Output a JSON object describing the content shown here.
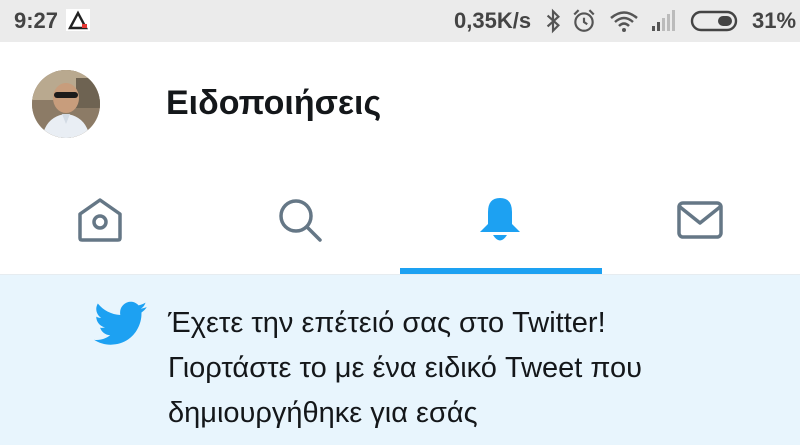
{
  "status_bar": {
    "time": "9:27",
    "network_speed": "0,35K/s",
    "battery_percent": "31%",
    "icons": [
      "bluetooth-icon",
      "alarm-icon",
      "wifi-icon",
      "signal-icon",
      "battery-icon"
    ]
  },
  "header": {
    "title": "Ειδοποιήσεις"
  },
  "tabs": [
    {
      "name": "home",
      "icon": "home-icon",
      "active": false
    },
    {
      "name": "search",
      "icon": "search-icon",
      "active": false
    },
    {
      "name": "notifications",
      "icon": "bell-icon",
      "active": true
    },
    {
      "name": "messages",
      "icon": "mail-icon",
      "active": false
    }
  ],
  "notification": {
    "line1": "Έχετε την επέτειό σας στο Twitter!",
    "line2": "Γιορτάστε το με ένα ειδικό Tweet που",
    "line3": "δημιουργήθηκε για εσάς",
    "icon": "twitter-bird-icon"
  },
  "colors": {
    "accent": "#1da1f2",
    "icon_inactive": "#657786",
    "notice_bg": "#e8f5fd",
    "status_bg": "#ebebeb"
  }
}
